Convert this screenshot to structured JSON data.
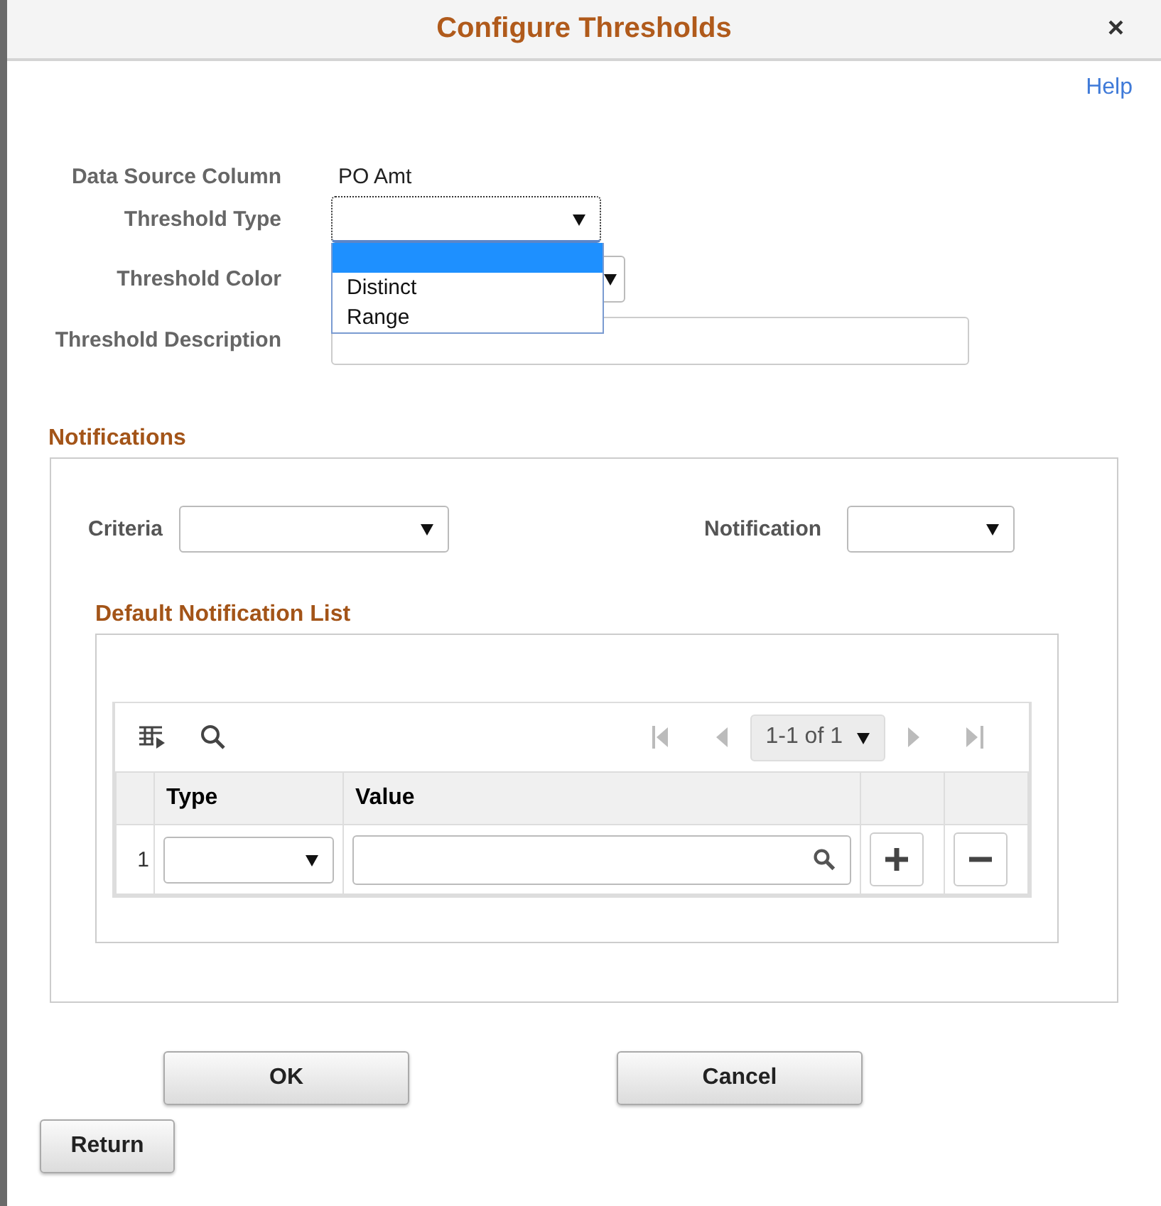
{
  "window": {
    "title": "Configure Thresholds",
    "close": "×"
  },
  "help_link": "Help",
  "form": {
    "data_source_column": {
      "label": "Data Source Column",
      "value": "PO Amt"
    },
    "threshold_type": {
      "label": "Threshold Type",
      "expanded": true,
      "options": [
        {
          "selected": true
        },
        {
          "label": "Distinct",
          "selected": false
        },
        {
          "label": "Range",
          "selected": false
        }
      ]
    },
    "threshold_color": {
      "label": "Threshold Color"
    },
    "threshold_description": {
      "label": "Threshold Description"
    }
  },
  "notifications": {
    "title": "Notifications",
    "criteria_label": "Criteria",
    "notification_label": "Notification",
    "default_list": {
      "title": "Default Notification List",
      "pager": "1-1 of 1",
      "columns": [
        "Type",
        "Value"
      ],
      "rows": [
        {
          "number": "1"
        }
      ]
    }
  },
  "buttons": [
    {
      "label": "OK",
      "kind": "primary"
    },
    {
      "label": "Cancel",
      "kind": "primary"
    },
    {
      "label": "Return",
      "kind": "secondary"
    }
  ]
}
